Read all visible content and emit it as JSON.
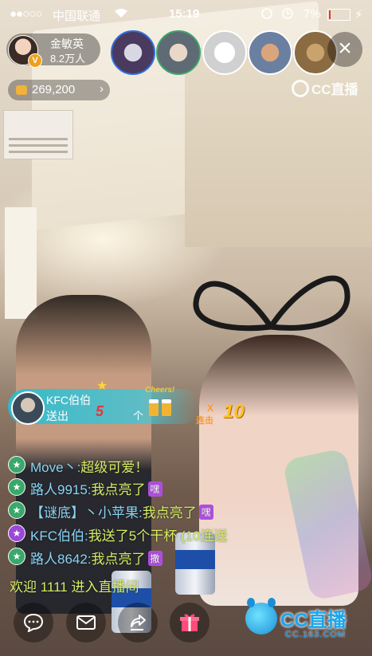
{
  "status_bar": {
    "signal": "●●○○○",
    "carrier": "中国联通",
    "time": "15:19",
    "battery_percent": "7%",
    "battery_level": 0.07
  },
  "host": {
    "name": "金敏英",
    "followers": "8.2万人",
    "vip_badge": "V"
  },
  "viewers": [
    {
      "icon": "viewer-avatar",
      "ring": "#2f6fe0"
    },
    {
      "icon": "viewer-avatar",
      "ring": "#3aa86a"
    },
    {
      "icon": "viewer-avatar",
      "ring": "#ffffff"
    },
    {
      "icon": "viewer-avatar",
      "ring": "#ffffff"
    },
    {
      "icon": "viewer-avatar",
      "ring": "#ffffff"
    }
  ],
  "coins": {
    "value": "269,200",
    "arrow": "›"
  },
  "watermark": "CC直播",
  "gift_banner": {
    "sender": "KFC伯伯",
    "action": "送出",
    "count": "5",
    "unit": "个",
    "gift_caption": "Cheers!",
    "combo_x": "X",
    "combo_label": "连击",
    "combo_number": "10"
  },
  "chat": [
    {
      "name": "Move丶:",
      "text": "超级可爱！",
      "tag": "",
      "badge_color": "#3aa86a"
    },
    {
      "name": "路人9915:",
      "text": "我点亮了",
      "tag": "嘿",
      "badge_color": "#3aa86a"
    },
    {
      "name": "【谜底】丶小苹果:",
      "text": "我点亮了",
      "tag": "嘿",
      "badge_color": "#3aa86a"
    },
    {
      "name": "KFC伯伯:",
      "text": "我送了5个干杯 (10连送",
      "tag": "",
      "badge_color": "#9b48d8"
    },
    {
      "name": "路人8642:",
      "text": "我点亮了",
      "tag": "撒",
      "badge_color": "#3aa86a"
    }
  ],
  "welcome": "欢迎 1111 进入直播间",
  "bottom_bar": {
    "chat_icon": "chat-bubble-icon",
    "message_icon": "envelope-icon",
    "share_icon": "share-icon",
    "gift_icon": "gift-icon"
  },
  "brand": {
    "name": "CC直播",
    "domain": "CC.163.COM",
    "color": "#1aa6ee"
  }
}
